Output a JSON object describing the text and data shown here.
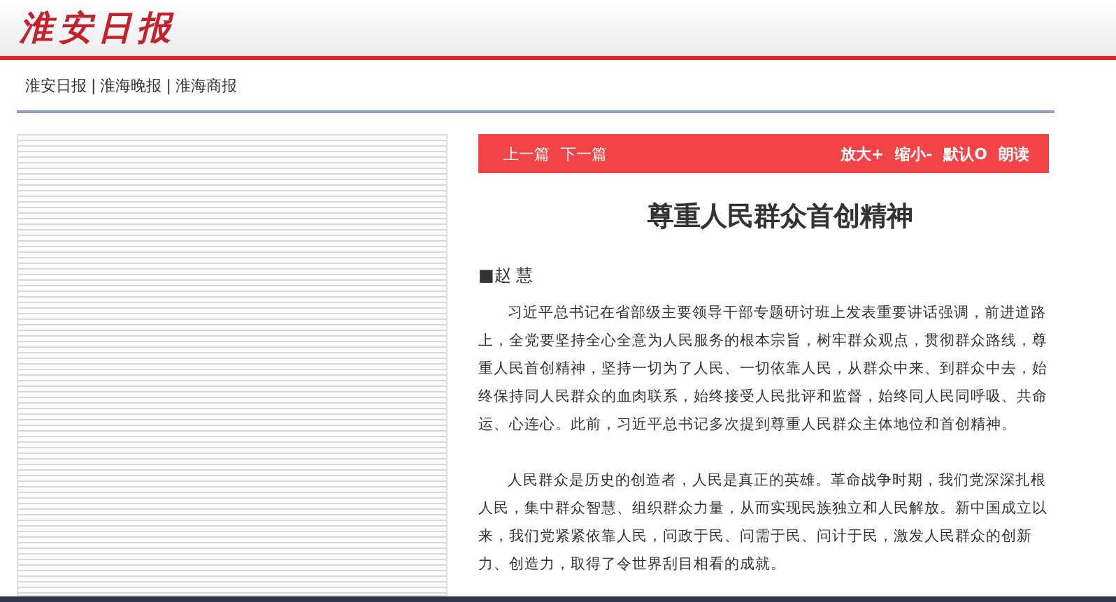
{
  "masthead": {
    "logo": "淮安日报"
  },
  "nav": {
    "links": [
      "淮安日报",
      "淮海晚报",
      "淮海商报"
    ],
    "separator": "|"
  },
  "toolbar": {
    "left": [
      "上一篇",
      "下一篇"
    ],
    "right": [
      "放大+",
      "缩小-",
      "默认O",
      "朗读"
    ]
  },
  "article": {
    "title": "尊重人民群众首创精神",
    "author": "■赵 慧",
    "paragraphs": [
      "习近平总书记在省部级主要领导干部专题研讨班上发表重要讲话强调，前进道路上，全党要坚持全心全意为人民服务的根本宗旨，树牢群众观点，贯彻群众路线，尊重人民首创精神，坚持一切为了人民、一切依靠人民，从群众中来、到群众中去，始终保持同人民群众的血肉联系，始终接受人民批评和监督，始终同人民同呼吸、共命运、心连心。此前，习近平总书记多次提到尊重人民群众主体地位和首创精神。",
      "人民群众是历史的创造者，人民是真正的英雄。革命战争时期，我们党深深扎根人民，集中群众智慧、组织群众力量，从而实现民族独立和人民解放。新中国成立以来，我们党紧紧依靠人民，问政于民、问需于民、问计于民，激发人民群众的创新力、创造力，取得了令世界刮目相看的成就。"
    ]
  }
}
